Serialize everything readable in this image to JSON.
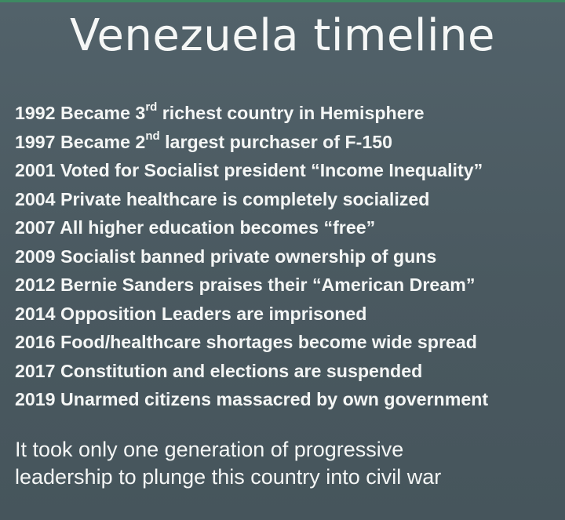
{
  "title": "Venezuela timeline",
  "timeline": [
    {
      "year": "1992",
      "pre": "Became 3",
      "sup": "rd",
      "post": " richest country in Hemisphere"
    },
    {
      "year": "1997",
      "pre": "Became 2",
      "sup": "nd",
      "post": " largest purchaser of F-150"
    },
    {
      "year": "2001",
      "pre": "Voted for Socialist president “Income Inequality”",
      "sup": "",
      "post": ""
    },
    {
      "year": "2004",
      "pre": "Private healthcare is completely socialized",
      "sup": "",
      "post": ""
    },
    {
      "year": "2007",
      "pre": "All higher education becomes “free”",
      "sup": "",
      "post": ""
    },
    {
      "year": "2009",
      "pre": "Socialist banned private ownership of guns",
      "sup": "",
      "post": ""
    },
    {
      "year": "2012",
      "pre": "Bernie Sanders praises their “American Dream”",
      "sup": "",
      "post": ""
    },
    {
      "year": "2014",
      "pre": "Opposition Leaders are imprisoned",
      "sup": "",
      "post": ""
    },
    {
      "year": "2016",
      "pre": "Food/healthcare shortages become wide spread",
      "sup": "",
      "post": ""
    },
    {
      "year": "2017",
      "pre": "Constitution and elections are suspended",
      "sup": "",
      "post": ""
    },
    {
      "year": "2019",
      "pre": "Unarmed citizens massacred by own government",
      "sup": "",
      "post": ""
    }
  ],
  "conclusion": {
    "line1": "It took only one generation of progressive",
    "line2": "leadership to plunge this country into civil war"
  },
  "colors": {
    "background": "#4c5b63",
    "text": "#f4f6f5",
    "top_strip": "#3d8a62"
  }
}
